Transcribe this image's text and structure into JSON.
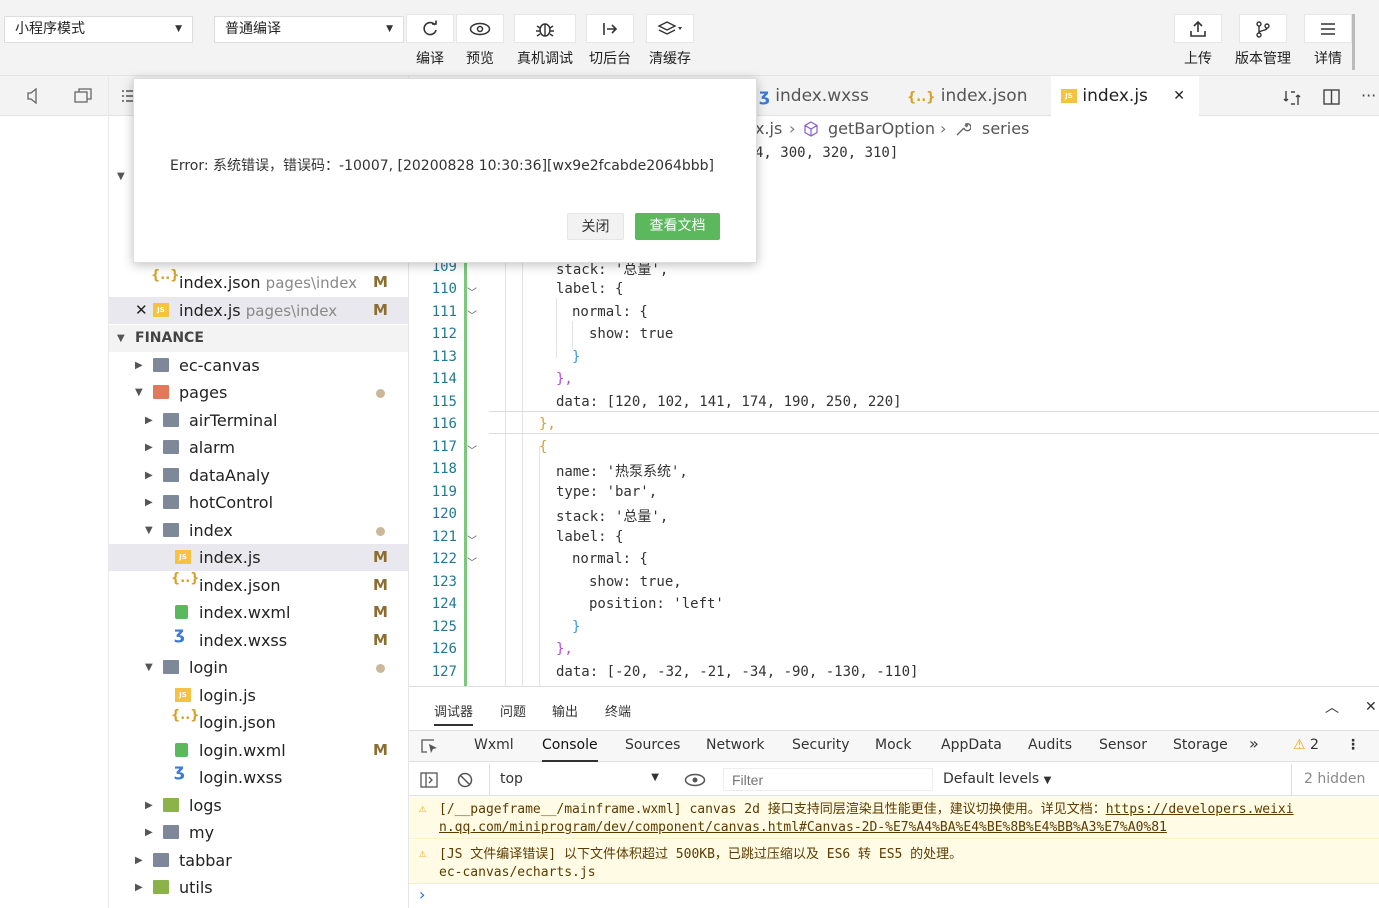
{
  "toolbar": {
    "mode_select": "小程序模式",
    "compile_select": "普通编译",
    "buttons": [
      {
        "label": "编译",
        "icon": "refresh-icon"
      },
      {
        "label": "预览",
        "icon": "eye-icon"
      },
      {
        "label": "真机调试",
        "icon": "bug-icon"
      },
      {
        "label": "切后台",
        "icon": "switch-background-icon"
      },
      {
        "label": "清缓存",
        "icon": "layers-icon"
      }
    ],
    "right_buttons": [
      {
        "label": "上传",
        "icon": "upload-icon"
      },
      {
        "label": "版本管理",
        "icon": "branch-icon"
      },
      {
        "label": "详情",
        "icon": "menu-icon"
      }
    ]
  },
  "sidebar": {
    "open_files": [
      {
        "name": "index.json",
        "path": "pages\\index",
        "status": "M"
      },
      {
        "name": "index.js",
        "path": "pages\\index",
        "status": "M"
      }
    ],
    "project_title": "FINANCE",
    "tree": [
      {
        "label": "ec-canvas"
      },
      {
        "label": "pages"
      },
      {
        "label": "airTerminal"
      },
      {
        "label": "alarm"
      },
      {
        "label": "dataAnaly"
      },
      {
        "label": "hotControl"
      },
      {
        "label": "index"
      },
      {
        "label": "index.js",
        "status": "M"
      },
      {
        "label": "index.json",
        "status": "M"
      },
      {
        "label": "index.wxml",
        "status": "M"
      },
      {
        "label": "index.wxss",
        "status": "M"
      },
      {
        "label": "login"
      },
      {
        "label": "login.js"
      },
      {
        "label": "login.json"
      },
      {
        "label": "login.wxml",
        "status": "M"
      },
      {
        "label": "login.wxss"
      },
      {
        "label": "logs"
      },
      {
        "label": "my"
      },
      {
        "label": "tabbar"
      },
      {
        "label": "utils"
      }
    ]
  },
  "editor": {
    "tabs": [
      {
        "label": "index.wxss"
      },
      {
        "label": "index.json"
      },
      {
        "label": "index.js"
      }
    ],
    "close_glyph": "✕",
    "breadcrumb": [
      "x.js",
      "getBarOption",
      "series"
    ],
    "first_line_fragment": "4, 300, 320, 310]",
    "partial_line_fragment": "stack: '总量',",
    "line_numbers": [
      "109",
      "110",
      "111",
      "112",
      "113",
      "114",
      "115",
      "116",
      "117",
      "118",
      "119",
      "120",
      "121",
      "122",
      "123",
      "124",
      "125",
      "126",
      "127"
    ],
    "lines": [
      "stack: '总量',",
      "label: {",
      "normal: {",
      "show: true",
      "}",
      "},",
      "data: [120, 102, 141, 174, 190, 250, 220]",
      "},",
      "{",
      "name: '热泵系统',",
      "type: 'bar',",
      "stack: '总量',",
      "label: {",
      "normal: {",
      "show: true,",
      "position: 'left'",
      "}",
      "},",
      "data: [-20, -32, -21, -34, -90, -130, -110]"
    ]
  },
  "devtools": {
    "top_tabs": [
      "调试器",
      "问题",
      "输出",
      "终端"
    ],
    "panel_tabs": [
      "Wxml",
      "Console",
      "Sources",
      "Network",
      "Security",
      "Mock",
      "AppData",
      "Audits",
      "Sensor",
      "Storage"
    ],
    "more": "»",
    "warn_count": "2",
    "context": "top",
    "filter_placeholder": "Filter",
    "levels": "Default levels",
    "hidden": "2 hidden",
    "messages": [
      {
        "text1": "[/__pageframe__/mainframe.wxml] canvas 2d 接口支持同层渲染且性能更佳，建议切换使用。详见文档：",
        "link1": "https://developers.weixi",
        "link2": "n.qq.com/miniprogram/dev/component/canvas.html#Canvas-2D-%E7%A4%BA%E4%BE%8B%E4%BB%A3%E7%A0%81"
      },
      {
        "text1": "[JS 文件编译错误] 以下文件体积超过 500KB，已跳过压缩以及 ES6 转 ES5 的处理。",
        "text2": "ec-canvas/echarts.js"
      }
    ],
    "prompt": "›"
  },
  "dialog": {
    "message": "Error: 系统错误，错误码：-10007, [20200828 10:30:36][wx9e2fcabde2064bbb]",
    "close_label": "关闭",
    "docs_label": "查看文档"
  },
  "colors": {
    "accent_green": "#5cb85c",
    "warn_bg": "#fffbe5"
  }
}
